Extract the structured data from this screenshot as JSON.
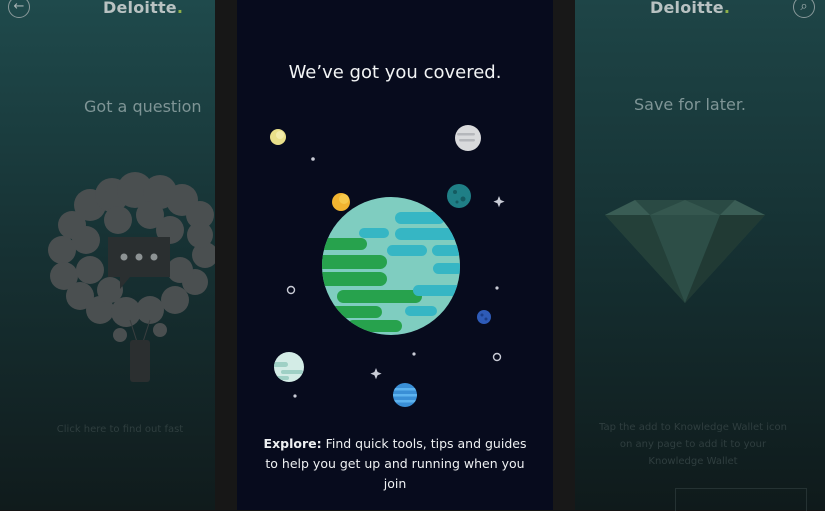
{
  "left_panel": {
    "brand": "Deloitte",
    "brand_dot": ".",
    "back_icon": "back-arrow-icon",
    "heading": "Got a question",
    "faded_text": "Click here to find out fast"
  },
  "main_panel": {
    "title": "We’ve got you covered.",
    "description_bold": "Explore:",
    "description": " Find quick tools, tips and guides to help you get up and running when you join",
    "illustration": "space-planets-illustration"
  },
  "right_panel": {
    "brand": "Deloitte",
    "brand_dot": ".",
    "search_icon": "search-icon",
    "heading": "Save for later.",
    "faded_text_1": "Tap the add to Knowledge Wallet icon",
    "faded_text_2": "on any page to add it to your",
    "faded_text_3": "Knowledge Wallet"
  },
  "colors": {
    "main_bg": "#070b1d",
    "planet_green": "#27a24d",
    "planet_teal": "#7fcdc0",
    "accent": "#8fb04a"
  }
}
